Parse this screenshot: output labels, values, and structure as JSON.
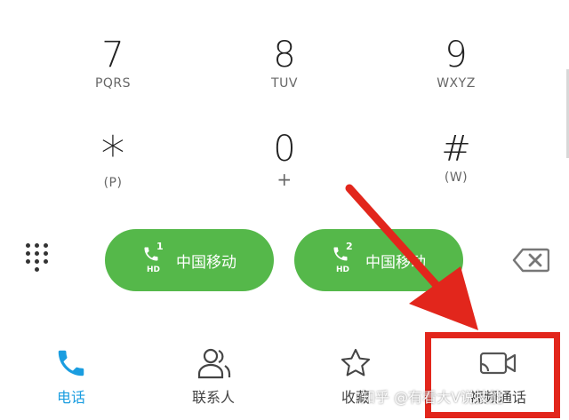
{
  "dialpad": {
    "keys": [
      {
        "num": "7",
        "letters": "PQRS"
      },
      {
        "num": "8",
        "letters": "TUV"
      },
      {
        "num": "9",
        "letters": "WXYZ"
      },
      {
        "num": "*",
        "letters": "(P)"
      },
      {
        "num": "0",
        "letters": "+"
      },
      {
        "num": "#",
        "letters": "(W)"
      }
    ]
  },
  "call_buttons": [
    {
      "sim": "1",
      "hd": "HD",
      "carrier": "中国移动"
    },
    {
      "sim": "2",
      "hd": "HD",
      "carrier": "中国移动"
    }
  ],
  "colors": {
    "call_green": "#55b84a",
    "active_blue": "#1a9de0",
    "annotation_red": "#e2261c"
  },
  "bottom_nav": {
    "tabs": [
      {
        "label": "电话",
        "icon": "phone-icon",
        "active": true
      },
      {
        "label": "联系人",
        "icon": "contacts-icon",
        "active": false
      },
      {
        "label": "收藏",
        "icon": "star-icon",
        "active": false
      },
      {
        "label": "视频通话",
        "icon": "video-call-icon",
        "active": false
      }
    ]
  },
  "watermark": "知乎 @有看大V说技能"
}
